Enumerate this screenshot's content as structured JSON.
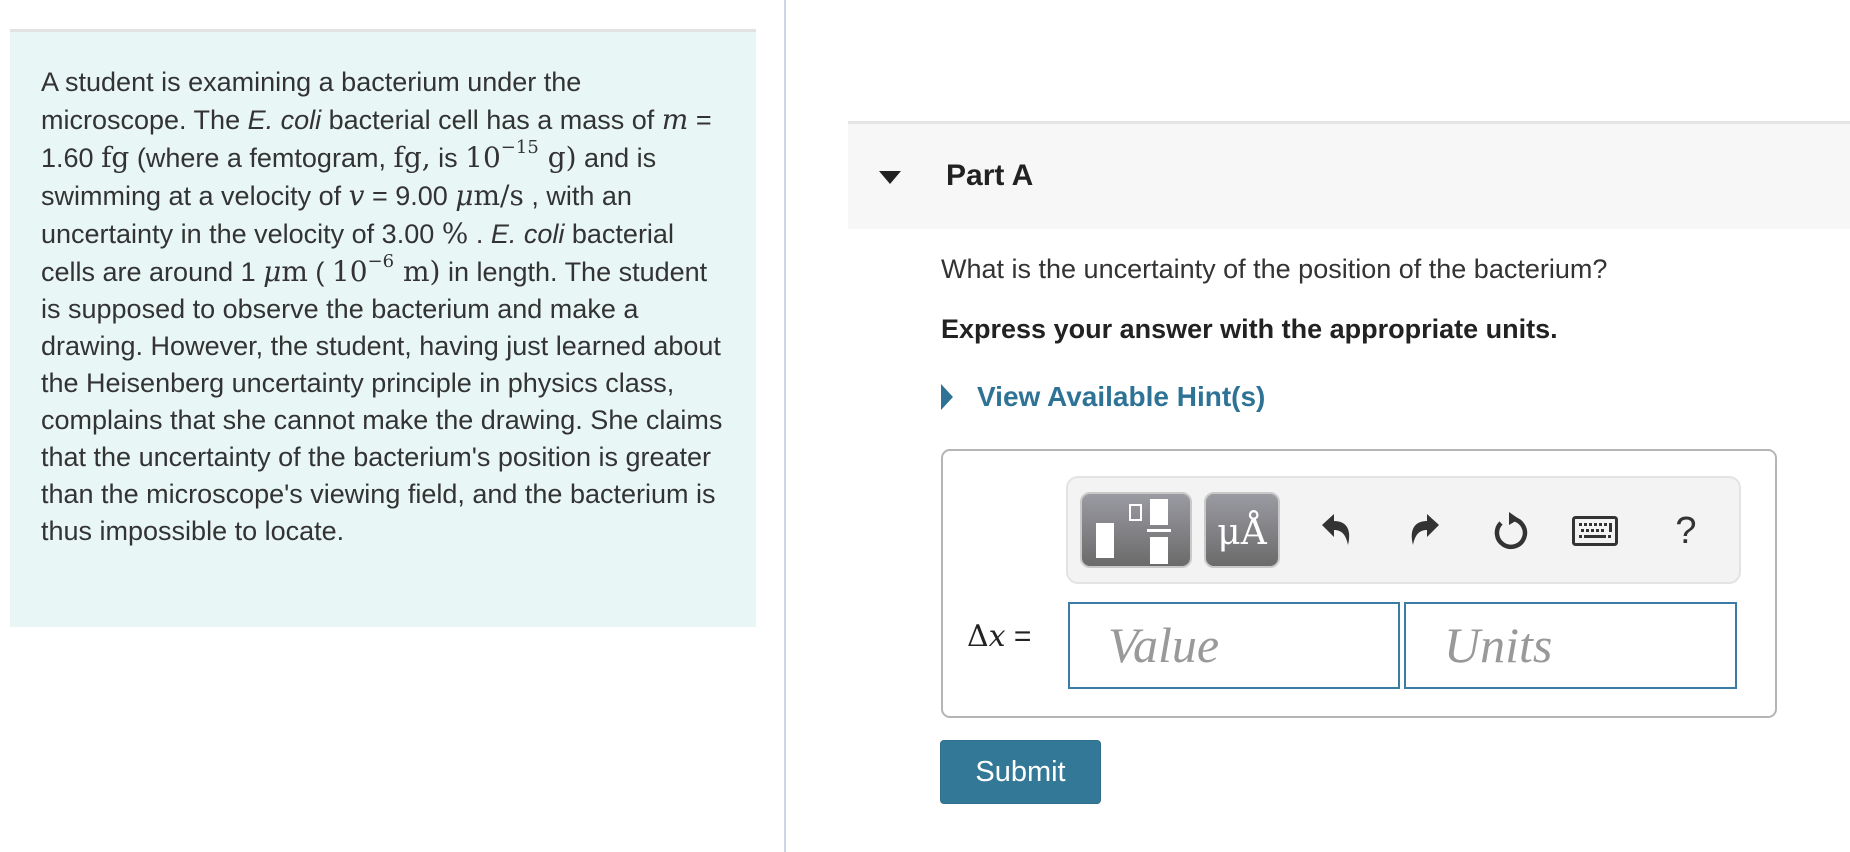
{
  "problem": {
    "s1": "A student is examining a bacterium under the microscope. The ",
    "ecoli1": "E. coli",
    "s2": " bacterial cell has a mass of ",
    "m_var": "m",
    "s3": " = 1.60 ",
    "fg": "fg",
    "s4": " (where a femtogram, ",
    "fg2": "fg,",
    "s5": "  is ",
    "ten": "10",
    "exp15": "−15",
    "g": " g)",
    "s6": " and is swimming at a velocity of ",
    "v_var": "v",
    "s7": " = 9.00 ",
    "mu": "μ",
    "ms": "m/s",
    "s8": " , with an uncertainty in the velocity of 3.00 ",
    "pct": "%",
    "s9": " . ",
    "ecoli2": "E. coli",
    "s10": " bacterial cells are around 1 ",
    "mu2": "μ",
    "m_unit": "m",
    "s11": " ( ",
    "ten2": "10",
    "exp6": "−6",
    "m2": " m)",
    "s12": " in length. The student is supposed to observe the bacterium and make a drawing. However, the student, having just learned about the Heisenberg uncertainty principle in physics class, complains that she cannot make the drawing. She claims that the uncertainty of the bacterium's position is greater than the microscope's viewing field, and the bacterium is thus impossible to locate."
  },
  "part": {
    "title": "Part A",
    "question": "What is the uncertainty of the position of the bacterium?",
    "instruction": "Express your answer with the appropriate units.",
    "hints_label": "View Available Hint(s)"
  },
  "toolbar": {
    "units_label": "μÅ",
    "help_label": "?"
  },
  "answer": {
    "delta": "Δ",
    "var": "x",
    "equals": " =",
    "value_placeholder": "Value",
    "units_placeholder": "Units"
  },
  "submit_label": "Submit",
  "colors": {
    "accent": "#347898",
    "link": "#2e7396",
    "problem_bg": "#e8f6f6"
  }
}
